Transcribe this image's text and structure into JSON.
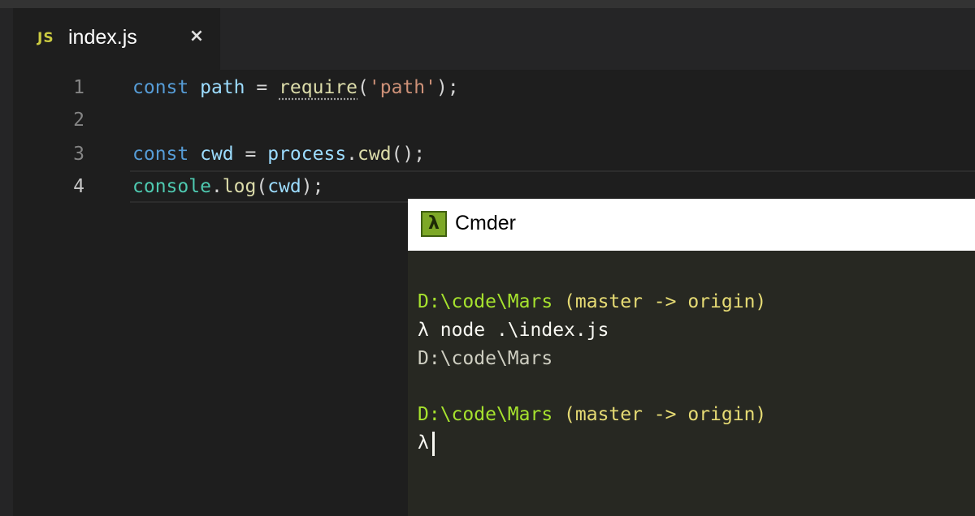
{
  "editor": {
    "tab": {
      "icon": "JS",
      "label": "index.js",
      "close": "×"
    },
    "lines": [
      {
        "num": "1"
      },
      {
        "num": "2"
      },
      {
        "num": "3"
      },
      {
        "num": "4"
      }
    ],
    "code": {
      "line1": {
        "kw": "const",
        "var": "path",
        "eq": "=",
        "fn": "require",
        "open": "(",
        "str": "'path'",
        "close": ");"
      },
      "line3": {
        "kw": "const",
        "var": "cwd",
        "eq": "=",
        "obj": "process",
        "dot": ".",
        "fn": "cwd",
        "call": "();"
      },
      "line4": {
        "obj": "console",
        "dot": ".",
        "fn": "log",
        "open": "(",
        "arg": "cwd",
        "close": ");"
      }
    }
  },
  "terminal": {
    "title": "Cmder",
    "icon": "λ",
    "lines": [
      {
        "path": "D:\\code\\Mars",
        "branch": "(master -> origin)"
      },
      {
        "prompt": "λ",
        "cmd": "node .\\index.js"
      },
      {
        "output": "D:\\code\\Mars"
      },
      {
        "path": "D:\\code\\Mars",
        "branch": "(master -> origin)"
      },
      {
        "prompt": "λ"
      }
    ]
  },
  "colors": {
    "editor_bg": "#1e1e1e",
    "terminal_bg": "#272822",
    "keyword": "#569cd6",
    "path_green": "#a6e22e",
    "branch_yellow": "#e6db74"
  }
}
